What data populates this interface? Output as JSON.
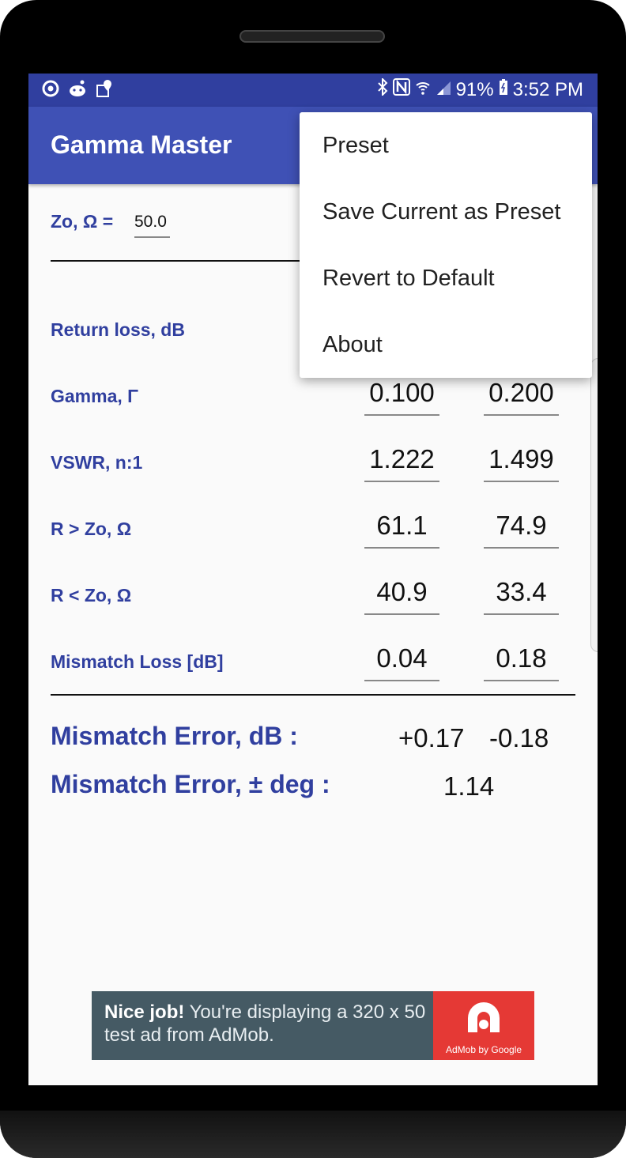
{
  "status_bar": {
    "left_icons": [
      "chrome-icon",
      "reddit-icon",
      "map-icon"
    ],
    "right_icons": [
      "bluetooth-icon",
      "nfc-icon",
      "wifi-icon",
      "signal-icon"
    ],
    "battery": "91%",
    "time": "3:52 PM"
  },
  "app_bar": {
    "title": "Gamma Master"
  },
  "zo": {
    "label": "Zo, Ω =",
    "value": "50.0"
  },
  "rows": [
    {
      "label": "Return loss, dB",
      "v1": "",
      "v2": ""
    },
    {
      "label": "Gamma, Γ",
      "v1": "0.100",
      "v2": "0.200"
    },
    {
      "label": "VSWR, n:1",
      "v1": "1.222",
      "v2": "1.499"
    },
    {
      "label": "R > Zo, Ω",
      "v1": "61.1",
      "v2": "74.9"
    },
    {
      "label": "R < Zo, Ω",
      "v1": "40.9",
      "v2": "33.4"
    },
    {
      "label": "Mismatch Loss [dB]",
      "v1": "0.04",
      "v2": "0.18"
    }
  ],
  "mismatch_error_db": {
    "label": "Mismatch Error, dB :",
    "plus": "+0.17",
    "minus": "-0.18"
  },
  "mismatch_error_deg": {
    "label": "Mismatch Error, ± deg :",
    "value": "1.14"
  },
  "overflow_menu": {
    "items": [
      "Preset",
      "Save Current as Preset",
      "Revert to Default",
      "About"
    ]
  },
  "ad": {
    "bold": "Nice job!",
    "text": " You're displaying a 320 x 50 test ad from AdMob.",
    "logo_text": "AdMob by Google"
  },
  "colors": {
    "primary": "#3f51b5",
    "primary_dark": "#303f9f",
    "ad_bg": "#455a64",
    "ad_logo": "#e53935"
  }
}
